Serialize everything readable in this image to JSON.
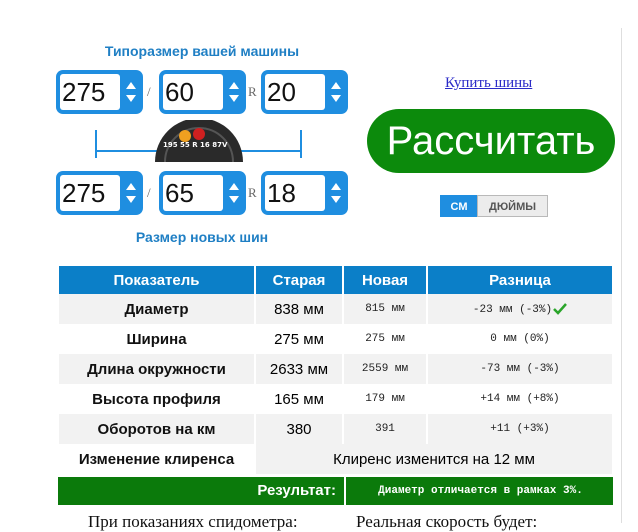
{
  "top_caption": "Типоразмер вашей машины",
  "bottom_caption": "Размер новых шин",
  "old_size": {
    "width": "275",
    "profile": "60",
    "radius": "20"
  },
  "new_size": {
    "width": "275",
    "profile": "65",
    "radius": "18"
  },
  "separator_slash": "/",
  "separator_r": "R",
  "tire_sidewall_text": "195  55  R 16 87V",
  "buy_link": "Купить шины",
  "calc_button": "Рассчитать",
  "units": {
    "cm": "СМ",
    "inch": "ДЮЙМЫ",
    "selected": "СМ"
  },
  "table": {
    "headers": [
      "Показатель",
      "Старая",
      "Новая",
      "Разница"
    ],
    "rows": [
      {
        "label": "Диаметр",
        "old": "838 мм",
        "new": "815 мм",
        "diff": "-23 мм (-3%)",
        "check": true
      },
      {
        "label": "Ширина",
        "old": "275 мм",
        "new": "275 мм",
        "diff": "0 мм (0%)"
      },
      {
        "label": "Длина окружности",
        "old": "2633 мм",
        "new": "2559 мм",
        "diff": "-73 мм (-3%)"
      },
      {
        "label": "Высота профиля",
        "old": "165 мм",
        "new": "179 мм",
        "diff": "+14 мм (+8%)"
      },
      {
        "label": "Оборотов на км",
        "old": "380",
        "new": "391",
        "diff": "+11 (+3%)"
      }
    ],
    "clearance_label": "Изменение клиренса",
    "clearance_value": "Клиренс изменится на 12 мм",
    "result_label": "Результат:",
    "result_value": "Диаметр отличается в рамках 3%."
  },
  "bottom_text_left": "При показаниях спидометра:",
  "bottom_text_right": "Реальная скорость будет:",
  "colors": {
    "accent": "#1f8ee0",
    "button_green": "#0c8a0c",
    "header_blue": "#0b7fc8",
    "result_green": "#0b7a0b"
  }
}
